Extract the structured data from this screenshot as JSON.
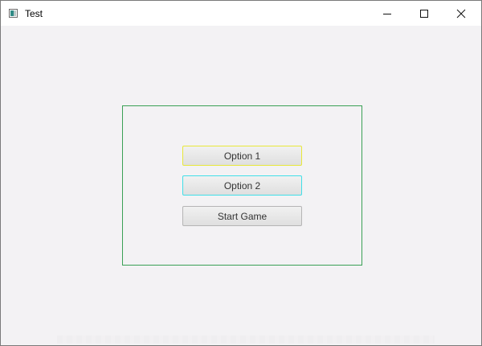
{
  "window": {
    "title": "Test",
    "controls": {
      "minimize": "minimize",
      "maximize": "maximize",
      "close": "close"
    }
  },
  "menu": {
    "option1_label": "Option 1",
    "option2_label": "Option 2",
    "start_label": "Start Game"
  },
  "colors": {
    "panel_border": "#3aa155",
    "option1_border": "#e8e83a",
    "option2_border": "#41dfe8",
    "background": "#f3f2f4"
  }
}
